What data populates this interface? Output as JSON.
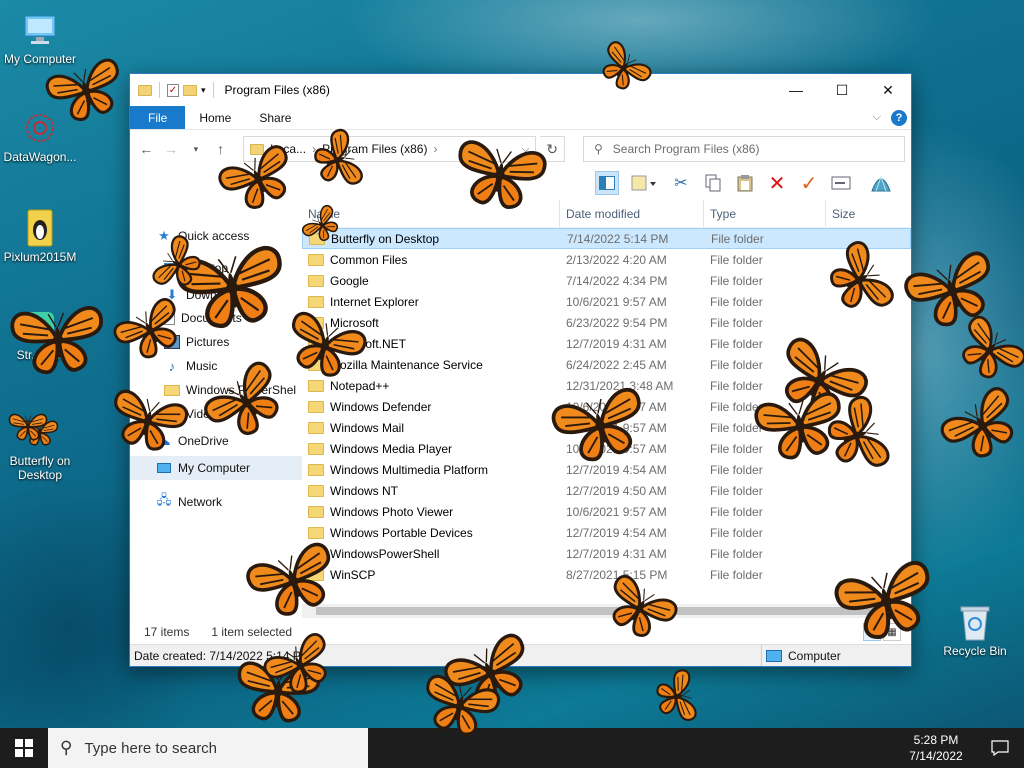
{
  "desktop": {
    "icons": [
      {
        "label": "My Computer",
        "icon": "computer-icon"
      },
      {
        "label": "DataWagon...",
        "icon": "datawagon-icon"
      },
      {
        "label": "Pixlum2015M",
        "icon": "pixlum-icon"
      },
      {
        "label": "Str... D...",
        "icon": "app-icon"
      },
      {
        "label": "Butterfly on Desktop",
        "icon": "butterfly-shortcut-icon"
      },
      {
        "label": "Recycle Bin",
        "icon": "recycle-bin-icon"
      }
    ]
  },
  "window": {
    "title": "Program Files (x86)",
    "controls": {
      "minimize": "—",
      "maximize": "☐",
      "close": "✕"
    },
    "ribbon_tabs": [
      "File",
      "Home",
      "Share"
    ],
    "address_segments": [
      "Loca...",
      "Program Files (x86)"
    ],
    "search_placeholder": "Search Program Files (x86)",
    "nav_pane": [
      {
        "label": "Quick access",
        "icon": "star-icon"
      },
      {
        "label": "Desktop",
        "icon": "desktop-folder-icon"
      },
      {
        "label": "Downloads",
        "icon": "download-icon"
      },
      {
        "label": "Documents",
        "icon": "documents-icon"
      },
      {
        "label": "Pictures",
        "icon": "pictures-icon"
      },
      {
        "label": "Music",
        "icon": "music-icon"
      },
      {
        "label": "Windows PowerShell Modules",
        "icon": "folder-icon"
      },
      {
        "label": "Videos",
        "icon": "videos-icon"
      },
      {
        "label": "OneDrive",
        "icon": "cloud-icon"
      },
      {
        "label": "My Computer",
        "icon": "computer-icon"
      },
      {
        "label": "Network",
        "icon": "network-icon"
      }
    ],
    "columns": [
      "Name",
      "Date modified",
      "Type",
      "Size"
    ],
    "files": [
      {
        "name": "Butterfly on Desktop",
        "date": "7/14/2022 5:14 PM",
        "type": "File folder"
      },
      {
        "name": "Common Files",
        "date": "2/13/2022 4:20 AM",
        "type": "File folder"
      },
      {
        "name": "Google",
        "date": "7/14/2022 4:34 PM",
        "type": "File folder"
      },
      {
        "name": "Internet Explorer",
        "date": "10/6/2021 9:57 AM",
        "type": "File folder"
      },
      {
        "name": "Microsoft",
        "date": "6/23/2022 9:54 PM",
        "type": "File folder"
      },
      {
        "name": "Microsoft.NET",
        "date": "12/7/2019 4:31 AM",
        "type": "File folder"
      },
      {
        "name": "Mozilla Maintenance Service",
        "date": "6/24/2022 2:45 AM",
        "type": "File folder"
      },
      {
        "name": "Notepad++",
        "date": "12/31/2021 3:48 AM",
        "type": "File folder"
      },
      {
        "name": "Windows Defender",
        "date": "10/6/2021 9:57 AM",
        "type": "File folder"
      },
      {
        "name": "Windows Mail",
        "date": "10/6/2021 9:57 AM",
        "type": "File folder"
      },
      {
        "name": "Windows Media Player",
        "date": "10/6/2021 9:57 AM",
        "type": "File folder"
      },
      {
        "name": "Windows Multimedia Platform",
        "date": "12/7/2019 4:54 AM",
        "type": "File folder"
      },
      {
        "name": "Windows NT",
        "date": "12/7/2019 4:50 AM",
        "type": "File folder"
      },
      {
        "name": "Windows Photo Viewer",
        "date": "10/6/2021 9:57 AM",
        "type": "File folder"
      },
      {
        "name": "Windows Portable Devices",
        "date": "12/7/2019 4:54 AM",
        "type": "File folder"
      },
      {
        "name": "WindowsPowerShell",
        "date": "12/7/2019 4:31 AM",
        "type": "File folder"
      },
      {
        "name": "WinSCP",
        "date": "8/27/2021 5:15 PM",
        "type": "File folder"
      }
    ],
    "selected_index": 0,
    "status": {
      "count": "17 items",
      "selection": "1 item selected"
    },
    "details": {
      "created": "Date created: 7/14/2022 5:14 PM",
      "location": "Computer"
    }
  },
  "taskbar": {
    "search_placeholder": "Type here to search",
    "time": "5:28 PM",
    "date": "7/14/2022"
  },
  "colors": {
    "accent": "#1979ca",
    "butterfly_orange": "#f08a1c",
    "butterfly_dark": "#2a1a0e"
  }
}
